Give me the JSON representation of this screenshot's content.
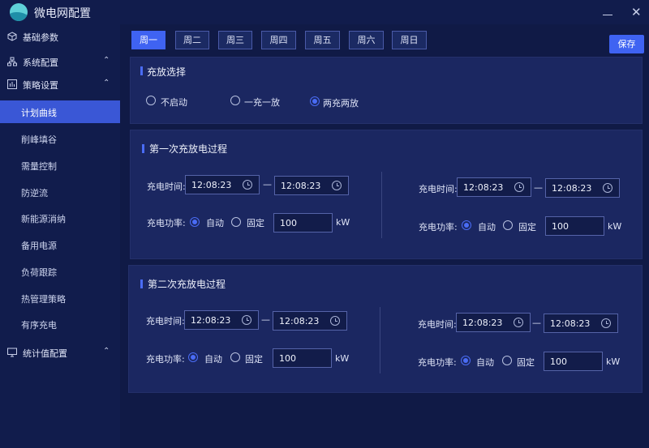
{
  "window": {
    "title": "微电网配置",
    "minimize_icon": "minimize-icon",
    "close_icon": "close-icon",
    "close_glyph": "✕"
  },
  "sidebar": {
    "items": [
      {
        "label": "基础参数",
        "icon": "cube-icon"
      },
      {
        "label": "系统配置",
        "icon": "network-icon",
        "chevron": "⌃"
      },
      {
        "label": "策略设置",
        "icon": "strategy-icon",
        "chevron": "⌃"
      },
      {
        "label": "统计值配置",
        "icon": "monitor-icon",
        "chevron": "⌃"
      }
    ],
    "sub_items": [
      {
        "label": "计划曲线",
        "active": true
      },
      {
        "label": "削峰填谷"
      },
      {
        "label": "需量控制"
      },
      {
        "label": "防逆流"
      },
      {
        "label": "新能源消纳"
      },
      {
        "label": "备用电源"
      },
      {
        "label": "负荷跟踪"
      },
      {
        "label": "热管理策略"
      },
      {
        "label": "有序充电"
      }
    ]
  },
  "tabs": [
    {
      "label": "周一",
      "active": true
    },
    {
      "label": "周二"
    },
    {
      "label": "周三"
    },
    {
      "label": "周四"
    },
    {
      "label": "周五"
    },
    {
      "label": "周六"
    },
    {
      "label": "周日"
    }
  ],
  "save_label": "保存",
  "charge_select": {
    "title": "充放选择",
    "options": [
      "不启动",
      "一充一放",
      "两充两放"
    ],
    "selected": "两充两放"
  },
  "processes": [
    {
      "title": "第一次充放电过程",
      "left": {
        "time_label": "充电时间:",
        "start": "12:08:23",
        "end": "12:08:23",
        "power_label": "充电功率:",
        "auto_label": "自动",
        "fixed_label": "固定",
        "power_value": "100",
        "unit": "kW"
      },
      "right": {
        "time_label": "充电时间:",
        "start": "12:08:23",
        "end": "12:08:23",
        "power_label": "充电功率:",
        "auto_label": "自动",
        "fixed_label": "固定",
        "power_value": "100",
        "unit": "kW"
      }
    },
    {
      "title": "第二次充放电过程",
      "left": {
        "time_label": "充电时间:",
        "start": "12:08:23",
        "end": "12:08:23",
        "power_label": "充电功率:",
        "auto_label": "自动",
        "fixed_label": "固定",
        "power_value": "100",
        "unit": "kW"
      },
      "right": {
        "time_label": "充电时间:",
        "start": "12:08:23",
        "end": "12:08:23",
        "power_label": "充电功率:",
        "auto_label": "自动",
        "fixed_label": "固定",
        "power_value": "100",
        "unit": "kW"
      }
    }
  ],
  "time_separator": "—",
  "colors": {
    "accent": "#3f63f2",
    "background": "#101a46",
    "sidebar": "#111c4c",
    "panel": "#1b2761"
  }
}
